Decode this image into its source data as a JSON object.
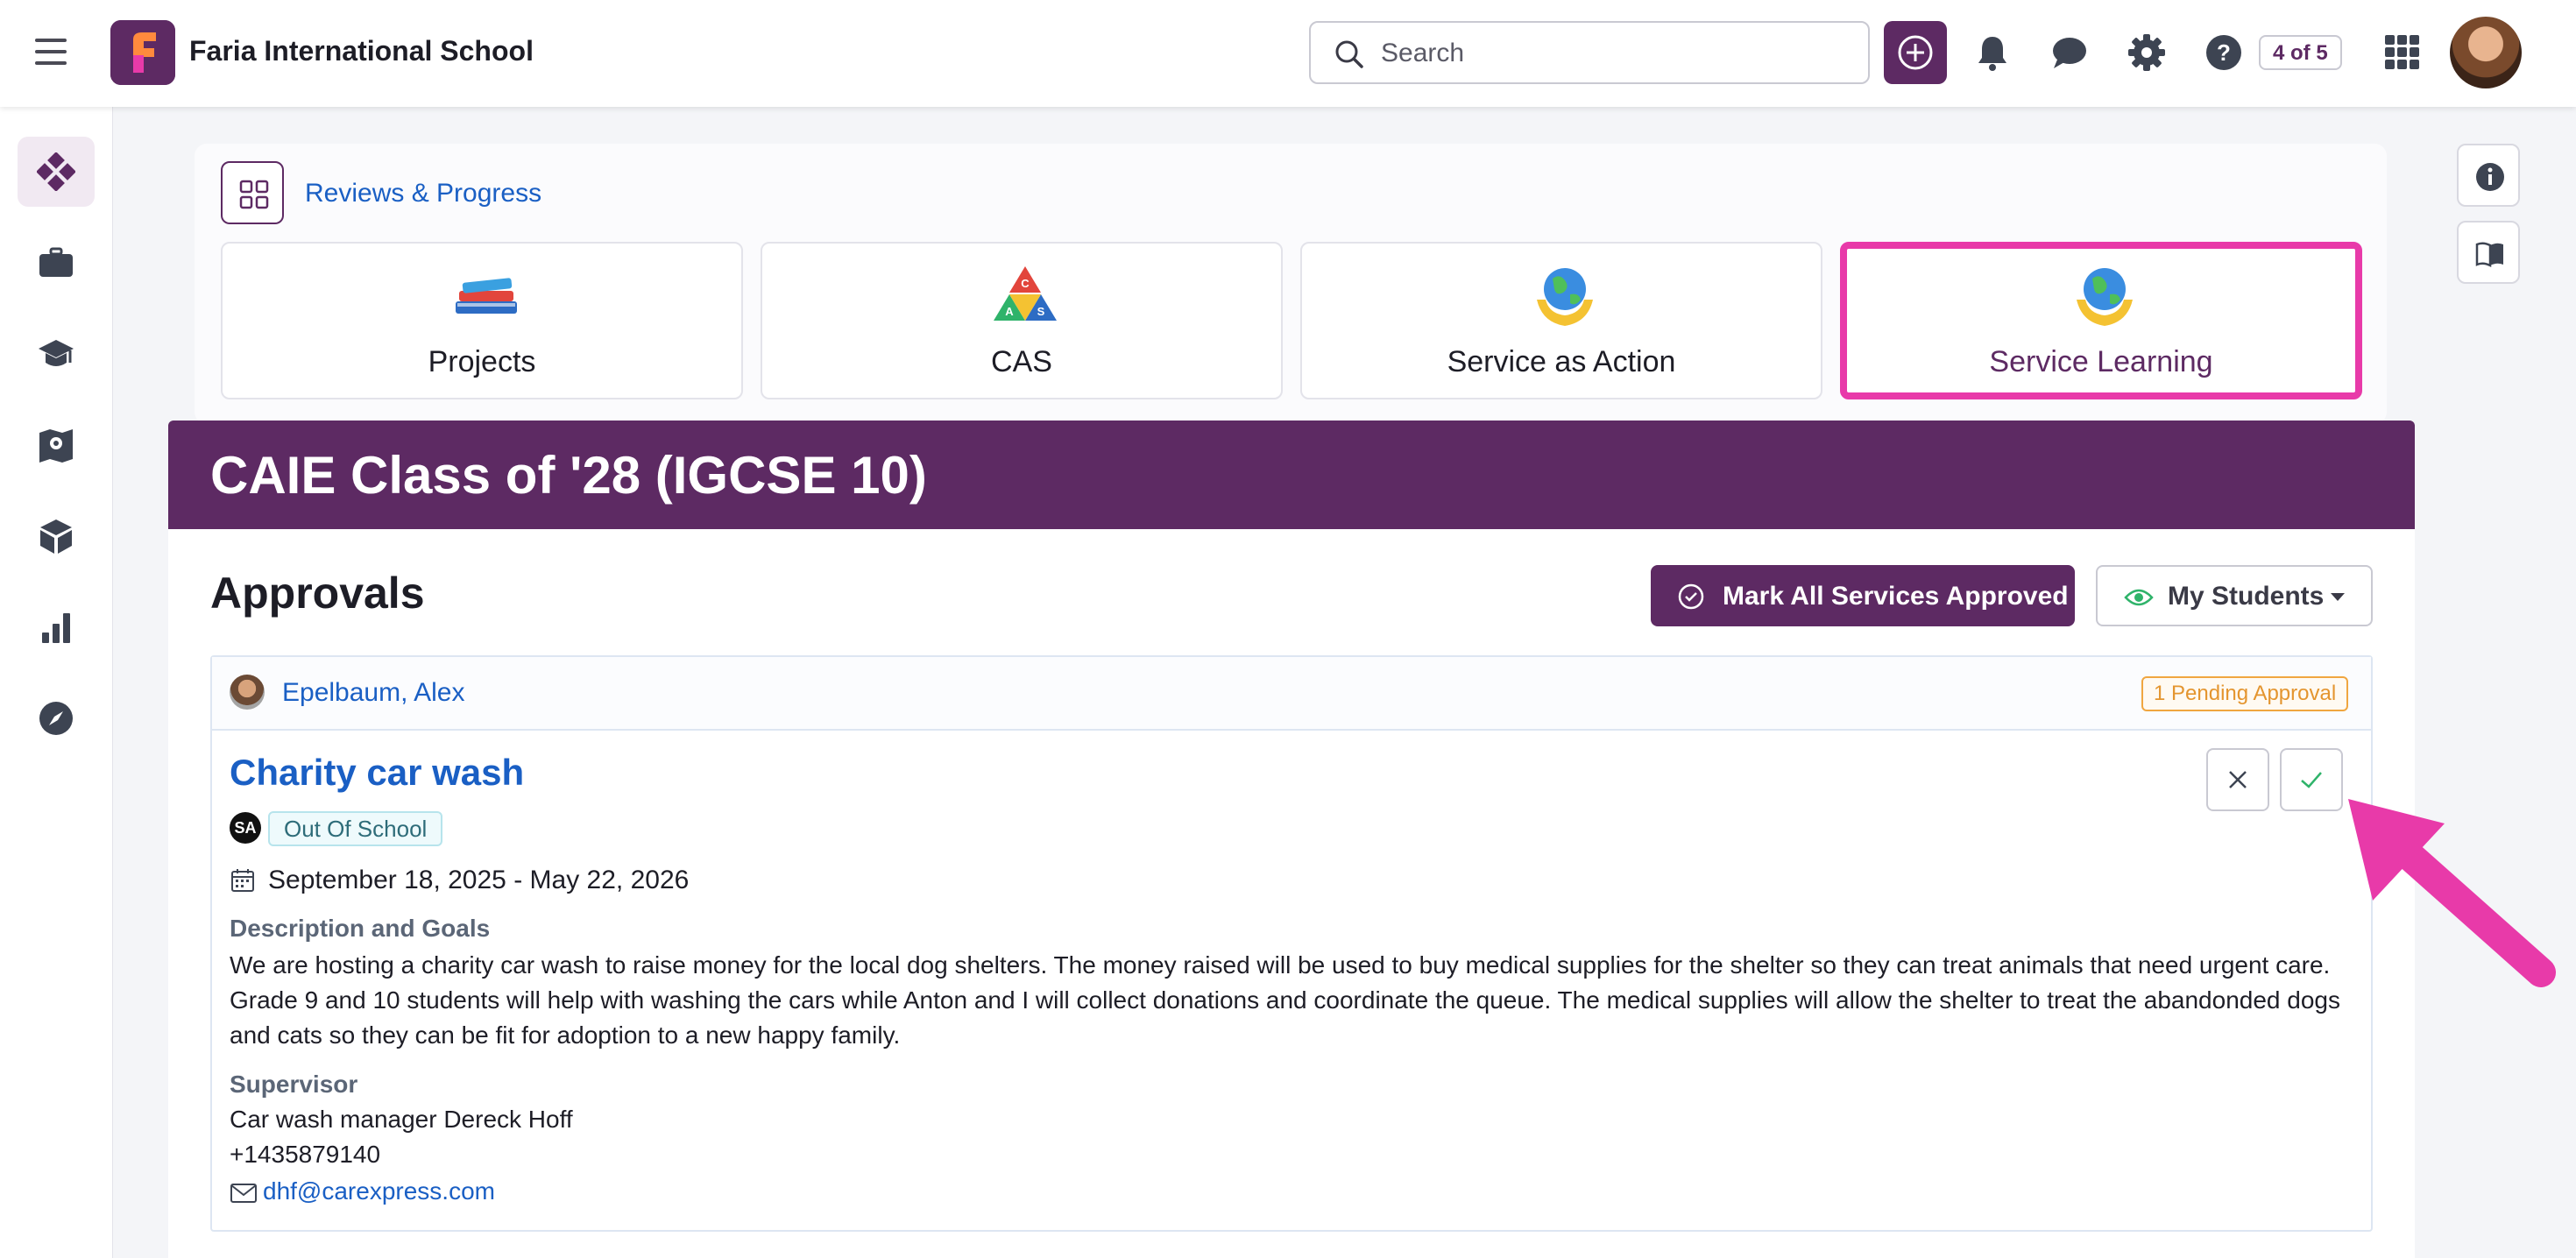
{
  "header": {
    "school_name": "Faria International School",
    "search_placeholder": "Search",
    "page_counter": "4 of 5"
  },
  "breadcrumb": {
    "link": "Reviews & Progress"
  },
  "tiles": [
    {
      "label": "Projects",
      "icon": "books-icon"
    },
    {
      "label": "CAS",
      "icon": "cas-triangle-icon"
    },
    {
      "label": "Service as Action",
      "icon": "globe-hands-icon"
    },
    {
      "label": "Service Learning",
      "icon": "globe-hands-icon",
      "highlighted": true
    }
  ],
  "banner": {
    "title": "CAIE Class of '28 (IGCSE 10)"
  },
  "approvals": {
    "title": "Approvals",
    "mark_all_label": "Mark All Services Approved",
    "filter_label": "My Students"
  },
  "service": {
    "student_name": "Epelbaum, Alex",
    "pending_badge": "1 Pending Approval",
    "title": "Charity car wash",
    "type_badge": "SA",
    "tag": "Out Of School",
    "dates": "September 18, 2025 - May 22, 2026",
    "description_label": "Description and Goals",
    "description": "We are hosting a charity car wash to raise money for the local dog shelters. The money raised will be used to buy medical supplies for the shelter so they can treat animals that need urgent care. Grade 9 and 10 students will help with washing the cars while Anton and I will collect donations and coordinate the queue. The medical supplies will allow the shelter to treat the abandonded dogs and cats so they can be fit for adoption to a new happy family.",
    "supervisor_label": "Supervisor",
    "supervisor_name": "Car wash manager Dereck Hoff",
    "supervisor_phone": "+1435879140",
    "supervisor_email": "dhf@carexpress.com"
  },
  "colors": {
    "brand": "#5d2a63",
    "link": "#1a5fc4",
    "highlight": "#e83aa9",
    "pending": "#f0a640",
    "approve": "#2fb36a"
  }
}
